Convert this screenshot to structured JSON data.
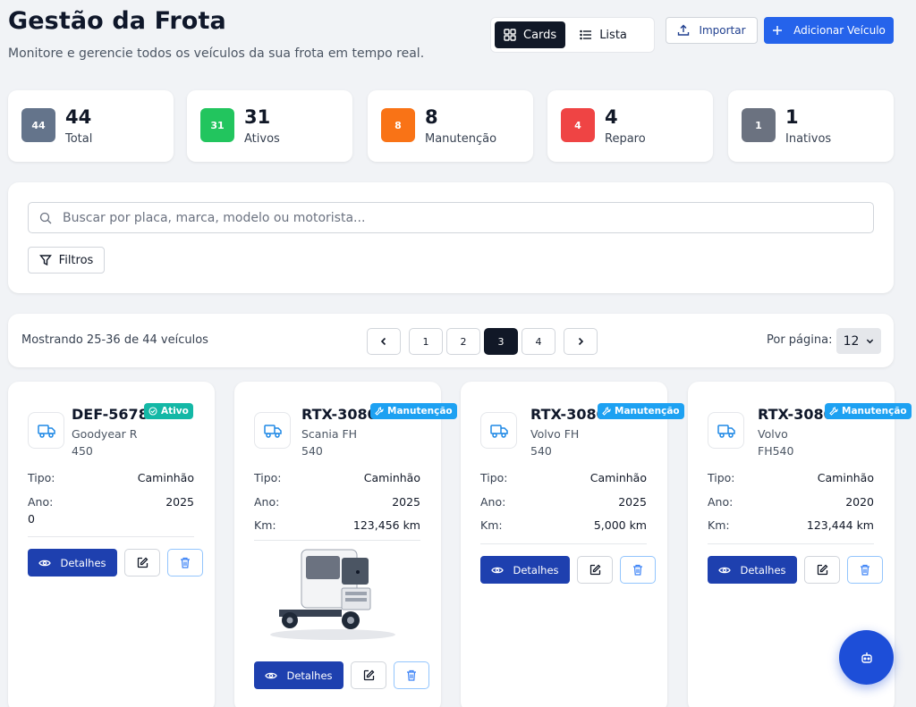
{
  "header": {
    "title": "Gestão da Frota",
    "subtitle": "Monitore e gerencie todos os veículos da sua frota em tempo real."
  },
  "toolbar": {
    "view_cards": "Cards",
    "view_list": "Lista",
    "import_label": "Importar",
    "add_label": "Adicionar Veículo"
  },
  "stats": [
    {
      "badge": "44",
      "value": "44",
      "label": "Total",
      "color": "#64748b"
    },
    {
      "badge": "31",
      "value": "31",
      "label": "Ativos",
      "color": "#22c55e"
    },
    {
      "badge": "8",
      "value": "8",
      "label": "Manutenção",
      "color": "#f97316"
    },
    {
      "badge": "4",
      "value": "4",
      "label": "Reparo",
      "color": "#ef4444"
    },
    {
      "badge": "1",
      "value": "1",
      "label": "Inativos",
      "color": "#6b7280"
    }
  ],
  "search": {
    "placeholder": "Buscar por placa, marca, modelo ou motorista...",
    "filters_label": "Filtros"
  },
  "pagination": {
    "showing": "Mostrando 25-36 de 44 veículos",
    "pages": [
      "1",
      "2",
      "3",
      "4"
    ],
    "current_page": "3",
    "per_page_label": "Por página:",
    "per_page_value": "12"
  },
  "labels": {
    "tipo": "Tipo:",
    "ano": "Ano:",
    "km": "Km:",
    "details": "Detalhes"
  },
  "vehicles": [
    {
      "plate": "DEF-5678",
      "status": "Ativo",
      "status_color": "#14b8a6",
      "brand": "Goodyear R",
      "model": "450",
      "tipo": "Caminhão",
      "ano": "2025",
      "km": "0"
    },
    {
      "plate": "RTX-3080",
      "status": "Manutenção",
      "status_color": "#1da1f2",
      "brand": "Scania FH",
      "model": "540",
      "tipo": "Caminhão",
      "ano": "2025",
      "km": "123,456 km"
    },
    {
      "plate": "RTX-3080",
      "status": "Manutenção",
      "status_color": "#1da1f2",
      "brand": "Volvo FH",
      "model": "540",
      "tipo": "Caminhão",
      "ano": "2025",
      "km": "5,000 km"
    },
    {
      "plate": "RTX-3080",
      "status": "Manutenção",
      "status_color": "#1da1f2",
      "brand": "Volvo",
      "model": "FH540",
      "tipo": "Caminhão",
      "ano": "2020",
      "km": "123,444 km"
    }
  ],
  "icons": {
    "cards": "grid-icon",
    "list": "list-icon",
    "import": "upload-icon",
    "add": "plus-icon",
    "search": "search-icon",
    "filter": "filter-icon",
    "vehicle": "truck-icon",
    "details": "eye-icon",
    "edit": "edit-icon",
    "delete": "trash-icon",
    "fab": "bot-icon"
  },
  "colors": {
    "primary": "#2563eb",
    "details_button": "#1e40af",
    "dark": "#111827"
  }
}
